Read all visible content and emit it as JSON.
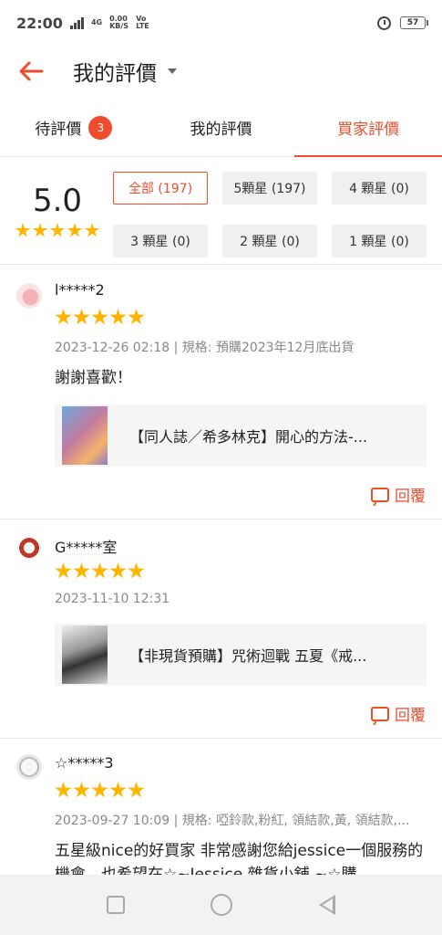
{
  "status_bar": {
    "time": "22:00",
    "network": "4G",
    "speed_value": "0.00",
    "speed_unit": "KB/S",
    "carrier": "Vo LTE",
    "battery": "57"
  },
  "header": {
    "title": "我的評價",
    "back_icon": "back-arrow-icon"
  },
  "tabs": [
    {
      "label": "待評價",
      "badge": "3"
    },
    {
      "label": "我的評價"
    },
    {
      "label": "買家評價",
      "active": true
    }
  ],
  "summary": {
    "score": "5.0",
    "stars": 5,
    "filters": [
      {
        "label": "全部 (197)",
        "active": true
      },
      {
        "label": "5顆星 (197)"
      },
      {
        "label": "4 顆星 (0)"
      },
      {
        "label": "3 顆星 (0)"
      },
      {
        "label": "2 顆星 (0)"
      },
      {
        "label": "1 顆星 (0)"
      }
    ]
  },
  "reviews": [
    {
      "user": "l*****2",
      "stars": 5,
      "meta": "2023-12-26 02:18 | 規格: 預購2023年12月底出貨",
      "comment": "謝謝喜歡！",
      "product": "【同人誌／希多林克】開心的方法-...",
      "reply_label": "回覆"
    },
    {
      "user": "G*****室",
      "stars": 5,
      "meta": "2023-11-10 12:31",
      "product": "【非現貨預購】咒術迴戰 五夏《戒...",
      "reply_label": "回覆"
    },
    {
      "user": "☆*****3",
      "stars": 5,
      "meta": "2023-09-27 10:09 | 規格: 啞鈴款,粉紅, 領結款,黃, 領結款,...",
      "comment": "五星級nice的好買家 非常感謝您給jessice一個服務的機會，也希望在☆~Jessice 雜貨小舖 ~☆購"
    }
  ],
  "colors": {
    "accent": "#ee4d2d",
    "star": "#ffb400"
  }
}
